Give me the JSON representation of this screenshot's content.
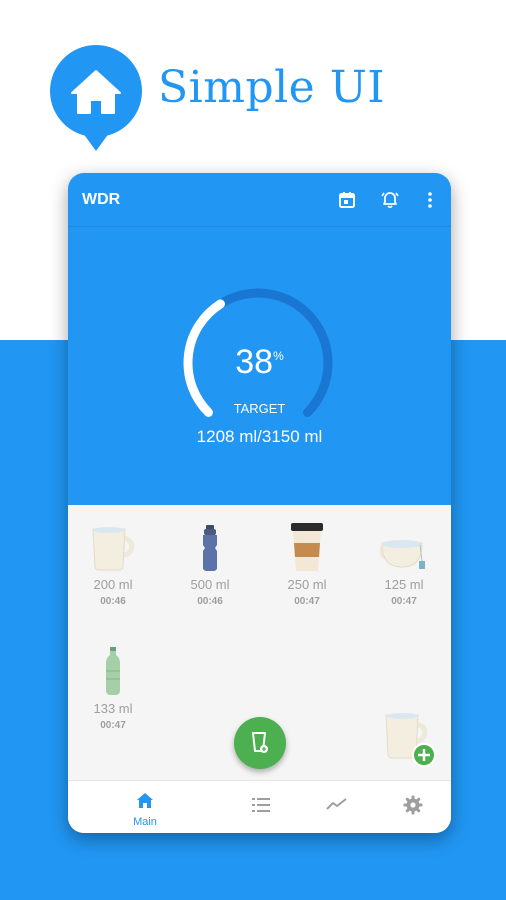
{
  "promo": {
    "title": "Simple UI",
    "icon": "home-icon"
  },
  "colors": {
    "primary": "#2196f3",
    "accent_green": "#4caf50",
    "muted_text": "#9e9e9e"
  },
  "appbar": {
    "title": "WDR",
    "actions": [
      "calendar-icon",
      "alarm-icon",
      "more-vert-icon"
    ]
  },
  "progress": {
    "percent": "38",
    "percent_sign": "%",
    "fraction": 0.38,
    "target_label": "TARGET",
    "intake_text": "1208 ml/3150 ml"
  },
  "drinks": [
    {
      "amount": "200 ml",
      "time": "00:46",
      "icon": "mug-icon"
    },
    {
      "amount": "500 ml",
      "time": "00:46",
      "icon": "sport-bottle-icon"
    },
    {
      "amount": "250 ml",
      "time": "00:47",
      "icon": "coffee-cup-icon"
    },
    {
      "amount": "125 ml",
      "time": "00:47",
      "icon": "tea-cup-icon"
    },
    {
      "amount": "133 ml",
      "time": "00:47",
      "icon": "water-bottle-icon"
    }
  ],
  "fab": {
    "icon": "add-drink-icon"
  },
  "add_cup": {
    "icon": "add-cup-icon"
  },
  "nav": {
    "items": [
      {
        "label": "Main",
        "icon": "home-icon",
        "active": true
      },
      {
        "label": "",
        "icon": "list-icon",
        "active": false
      },
      {
        "label": "",
        "icon": "chart-icon",
        "active": false
      },
      {
        "label": "",
        "icon": "settings-icon",
        "active": false
      }
    ]
  }
}
